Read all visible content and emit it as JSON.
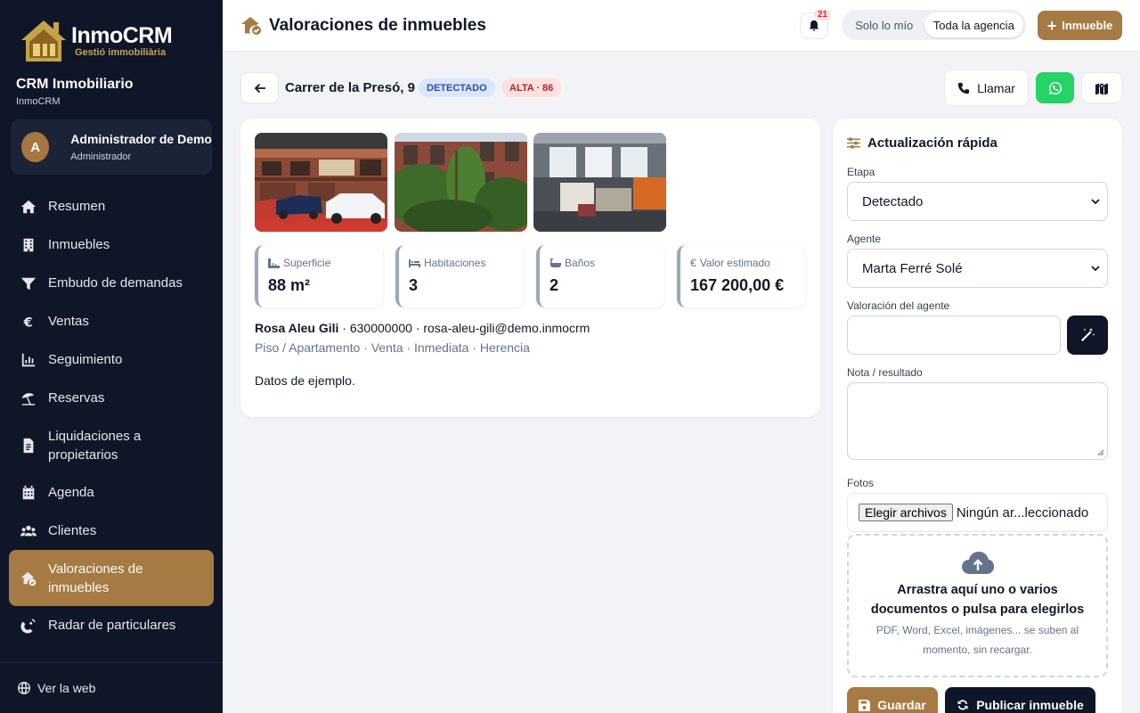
{
  "brand": {
    "name": "InmoCRM",
    "subtitle": "Gestió immobiliària"
  },
  "crm": {
    "title": "CRM Inmobiliario",
    "subtitle": "InmoCRM"
  },
  "user": {
    "initial": "A",
    "name": "Administrador de Demo",
    "role": "Administrador"
  },
  "nav": [
    {
      "label": "Resumen",
      "icon": "home-icon"
    },
    {
      "label": "Inmuebles",
      "icon": "building-icon"
    },
    {
      "label": "Embudo de demandas",
      "icon": "funnel-icon"
    },
    {
      "label": "Ventas",
      "icon": "euro-icon"
    },
    {
      "label": "Seguimiento",
      "icon": "chart-icon"
    },
    {
      "label": "Reservas",
      "icon": "umbrella-icon"
    },
    {
      "label": "Liquidaciones a propietarios",
      "icon": "invoice-icon"
    },
    {
      "label": "Agenda",
      "icon": "calendar-icon"
    },
    {
      "label": "Clientes",
      "icon": "users-icon"
    },
    {
      "label": "Valoraciones de inmuebles",
      "icon": "house-check-icon"
    },
    {
      "label": "Radar de particulares",
      "icon": "radar-icon"
    }
  ],
  "footer": {
    "label": "Ver la web"
  },
  "topbar": {
    "title": "Valoraciones de inmuebles",
    "notifications": "21",
    "scope_mine": "Solo lo mío",
    "scope_agency": "Toda la agencia",
    "add_label": "Inmueble"
  },
  "property": {
    "address": "Carrer de la Presó, 9",
    "stage_badge": "DETECTADO",
    "priority_badge": "ALTA · 86",
    "call_label": "Llamar",
    "stats": [
      {
        "label": "Superficie",
        "value": "88 m²"
      },
      {
        "label": "Habitaciones",
        "value": "3"
      },
      {
        "label": "Baños",
        "value": "2"
      },
      {
        "label": "Valor estimado",
        "value": "167 200,00 €"
      }
    ],
    "owner_name": "Rosa Aleu Gili",
    "owner_contact": " · 630000000 · rosa-aleu-gili@demo.inmocrm",
    "tags": "Piso / Apartamento · Venta · Inmediata · Herencia",
    "note": "Datos de ejemplo."
  },
  "panel": {
    "title": "Actualización rápida",
    "stage_label": "Etapa",
    "stage_value": "Detectado",
    "agent_label": "Agente",
    "agent_value": "Marta Ferré Solé",
    "valuation_label": "Valoración del agente",
    "note_label": "Nota / resultado",
    "photos_label": "Fotos",
    "file_button": "Elegir archivos",
    "file_status": "Ningún ar...leccionado",
    "dropzone_title": "Arrastra aquí uno o varios documentos o pulsa para elegirlos",
    "dropzone_sub": "PDF, Word, Excel, imágenes... se suben al momento, sin recargar.",
    "save_label": "Guardar",
    "publish_label": "Publicar inmueble"
  },
  "colors": {
    "sidebar": "#0e1628",
    "accent": "#a67a43",
    "whatsapp": "#25d366"
  }
}
